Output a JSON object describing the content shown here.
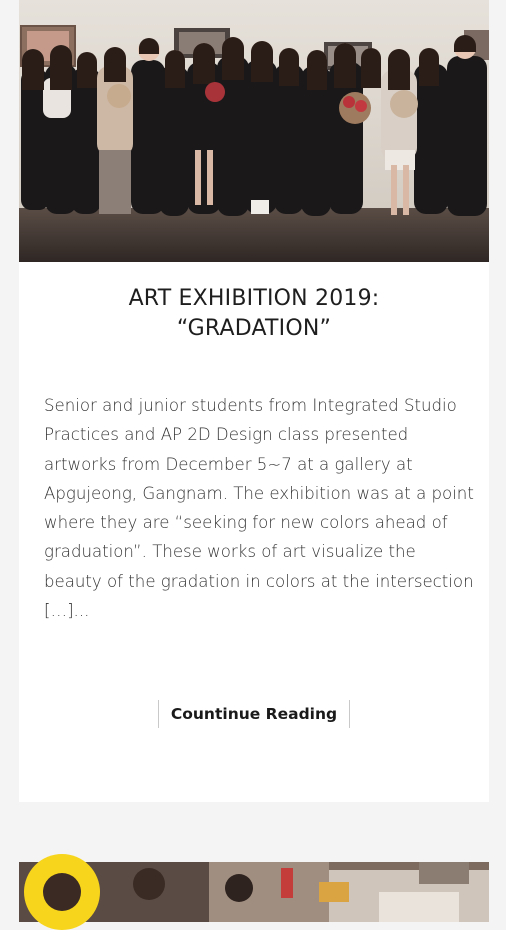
{
  "post": {
    "image_alt": "Group photo of students at the exhibition",
    "title": "ART EXHIBITION 2019:\n“GRADATION”",
    "excerpt": "Senior and junior students from Integrated Studio Practices and AP 2D Design class presented artworks from December 5~7 at a gallery at Apgujeong, Gangnam. The exhibition was at a point where they are “seeking for new colors ahead of graduation”. These works of art visualize the beauty of the gradation in colors at the intersection […]...",
    "read_more_label": "Countinue Reading"
  },
  "next_post": {
    "image_alt": "Students working in an art studio"
  },
  "colors": {
    "background": "#f4f4f4",
    "card": "#ffffff",
    "title": "#1e1e1e",
    "badge": "#f7d51c"
  }
}
